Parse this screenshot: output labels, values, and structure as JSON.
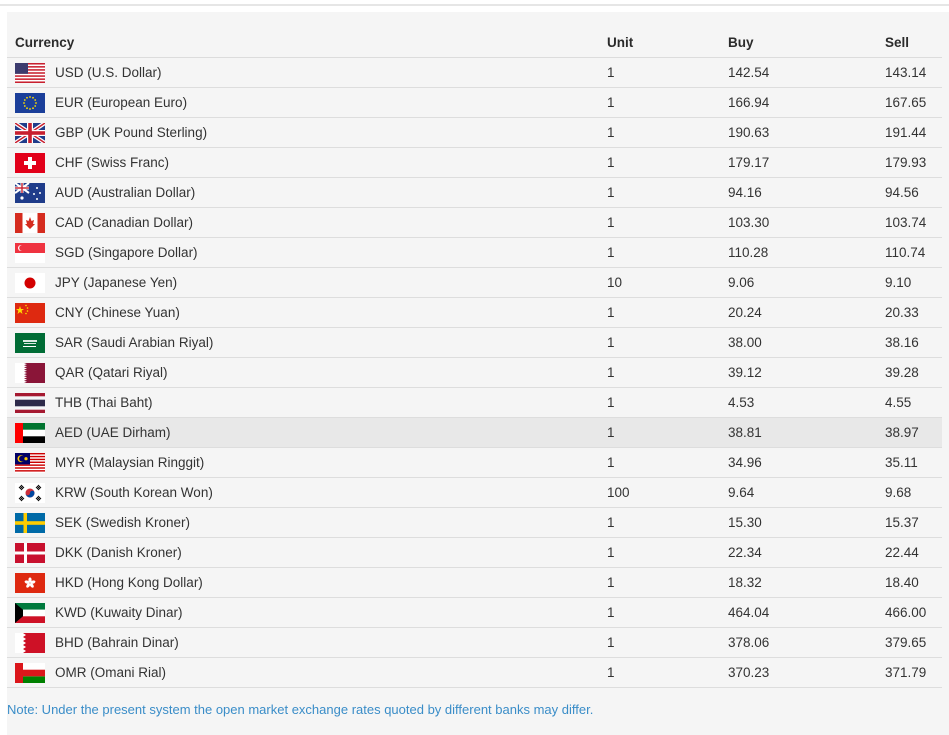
{
  "table": {
    "headers": {
      "currency": "Currency",
      "unit": "Unit",
      "buy": "Buy",
      "sell": "Sell"
    },
    "rows": [
      {
        "flag": "us-flag-icon",
        "name": "USD (U.S. Dollar)",
        "unit": "1",
        "buy": "142.54",
        "sell": "143.14"
      },
      {
        "flag": "eu-flag-icon",
        "name": "EUR (European Euro)",
        "unit": "1",
        "buy": "166.94",
        "sell": "167.65"
      },
      {
        "flag": "uk-flag-icon",
        "name": "GBP (UK Pound Sterling)",
        "unit": "1",
        "buy": "190.63",
        "sell": "191.44"
      },
      {
        "flag": "ch-flag-icon",
        "name": "CHF (Swiss Franc)",
        "unit": "1",
        "buy": "179.17",
        "sell": "179.93"
      },
      {
        "flag": "au-flag-icon",
        "name": "AUD (Australian Dollar)",
        "unit": "1",
        "buy": "94.16",
        "sell": "94.56"
      },
      {
        "flag": "ca-flag-icon",
        "name": "CAD (Canadian Dollar)",
        "unit": "1",
        "buy": "103.30",
        "sell": "103.74"
      },
      {
        "flag": "sg-flag-icon",
        "name": "SGD (Singapore Dollar)",
        "unit": "1",
        "buy": "110.28",
        "sell": "110.74"
      },
      {
        "flag": "jp-flag-icon",
        "name": "JPY (Japanese Yen)",
        "unit": "10",
        "buy": "9.06",
        "sell": "9.10"
      },
      {
        "flag": "cn-flag-icon",
        "name": "CNY (Chinese Yuan)",
        "unit": "1",
        "buy": "20.24",
        "sell": "20.33"
      },
      {
        "flag": "sa-flag-icon",
        "name": "SAR (Saudi Arabian Riyal)",
        "unit": "1",
        "buy": "38.00",
        "sell": "38.16"
      },
      {
        "flag": "qa-flag-icon",
        "name": "QAR (Qatari Riyal)",
        "unit": "1",
        "buy": "39.12",
        "sell": "39.28"
      },
      {
        "flag": "th-flag-icon",
        "name": "THB (Thai Baht)",
        "unit": "1",
        "buy": "4.53",
        "sell": "4.55"
      },
      {
        "flag": "ae-flag-icon",
        "name": "AED (UAE Dirham)",
        "unit": "1",
        "buy": "38.81",
        "sell": "38.97"
      },
      {
        "flag": "my-flag-icon",
        "name": "MYR (Malaysian Ringgit)",
        "unit": "1",
        "buy": "34.96",
        "sell": "35.11"
      },
      {
        "flag": "kr-flag-icon",
        "name": "KRW (South Korean Won)",
        "unit": "100",
        "buy": "9.64",
        "sell": "9.68"
      },
      {
        "flag": "se-flag-icon",
        "name": "SEK (Swedish Kroner)",
        "unit": "1",
        "buy": "15.30",
        "sell": "15.37"
      },
      {
        "flag": "dk-flag-icon",
        "name": "DKK (Danish Kroner)",
        "unit": "1",
        "buy": "22.34",
        "sell": "22.44"
      },
      {
        "flag": "hk-flag-icon",
        "name": "HKD (Hong Kong Dollar)",
        "unit": "1",
        "buy": "18.32",
        "sell": "18.40"
      },
      {
        "flag": "kw-flag-icon",
        "name": "KWD (Kuwaity Dinar)",
        "unit": "1",
        "buy": "464.04",
        "sell": "466.00"
      },
      {
        "flag": "bh-flag-icon",
        "name": "BHD (Bahrain Dinar)",
        "unit": "1",
        "buy": "378.06",
        "sell": "379.65"
      },
      {
        "flag": "om-flag-icon",
        "name": "OMR (Omani Rial)",
        "unit": "1",
        "buy": "370.23",
        "sell": "371.79"
      }
    ],
    "highlighted_row": "AED (UAE Dirham)"
  },
  "note": "Note: Under the present system the open market exchange rates quoted by different banks may differ.",
  "colors": {
    "note": "#3a8dc8",
    "row_highlight": "#e8e8e8",
    "panel_bg": "#f5f5f5"
  }
}
